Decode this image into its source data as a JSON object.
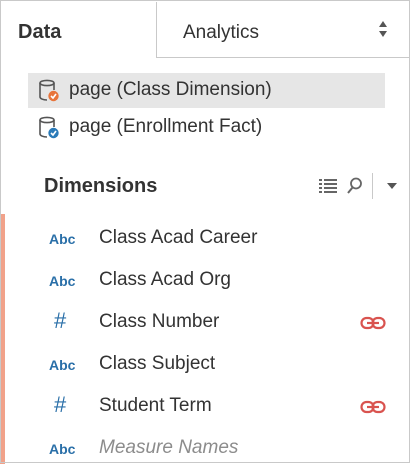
{
  "tabs": {
    "data_label": "Data",
    "analytics_label": "Analytics"
  },
  "data_sources": [
    {
      "label": "page (Class Dimension)",
      "selected": true
    },
    {
      "label": "page (Enrollment Fact)",
      "selected": false
    }
  ],
  "dimensions": {
    "title": "Dimensions",
    "fields": [
      {
        "type_label": "Abc",
        "label": "Class Acad Career",
        "type": "string",
        "linked": false
      },
      {
        "type_label": "Abc",
        "label": "Class Acad Org",
        "type": "string",
        "linked": false
      },
      {
        "type_label": "#",
        "label": "Class Number",
        "type": "number",
        "linked": true
      },
      {
        "type_label": "Abc",
        "label": "Class Subject",
        "type": "string",
        "linked": false
      },
      {
        "type_label": "#",
        "label": "Student Term",
        "type": "number",
        "linked": true
      },
      {
        "type_label": "Abc",
        "label": "Measure Names",
        "type": "string",
        "linked": false,
        "italic": true
      }
    ]
  },
  "colors": {
    "type_icon": "#2a6fa8",
    "link_icon": "#d9534f",
    "datasource_badge": "#e8743b",
    "datasource_badge_alt": "#2a7ab8",
    "selected_row": "#e6e6e6",
    "left_accent": "#f1a28a"
  },
  "icons": {
    "updown": "updown-arrows-icon",
    "datasource": "database-icon",
    "view_toggle": "list-view-icon",
    "search": "search-icon",
    "menu": "dropdown-arrow-icon",
    "link": "link-icon"
  }
}
